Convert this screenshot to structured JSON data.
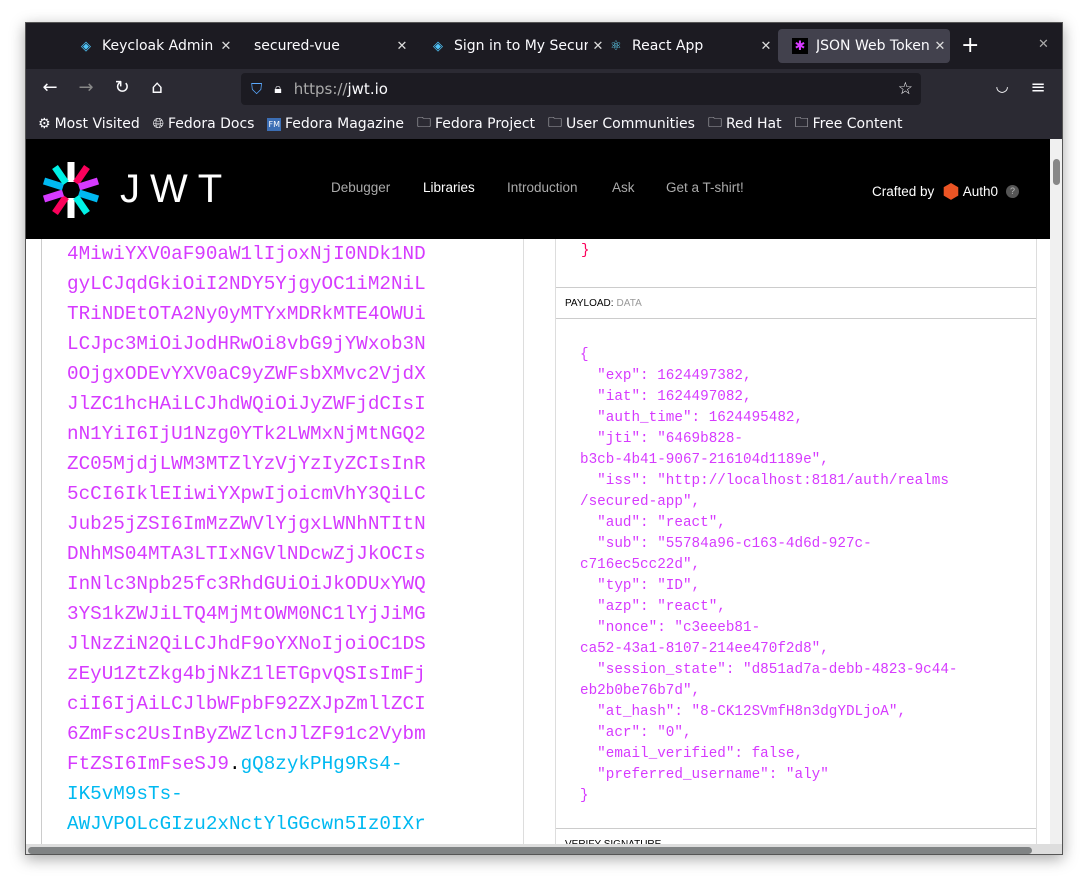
{
  "browser": {
    "tabs": [
      {
        "label": "Keycloak Admin Co",
        "icon": "keycloak-icon",
        "active": false
      },
      {
        "label": "secured-vue",
        "icon": "",
        "active": false
      },
      {
        "label": "Sign in to My Secur",
        "icon": "keycloak-icon",
        "active": false
      },
      {
        "label": "React App",
        "icon": "react-icon",
        "active": false
      },
      {
        "label": "JSON Web Tokens",
        "icon": "jwt-icon",
        "active": true
      }
    ],
    "url_protocol": "https://",
    "url_host": "jwt.io",
    "bookmarks": [
      {
        "label": "Most Visited",
        "icon": "gear-icon"
      },
      {
        "label": "Fedora Docs",
        "icon": "globe-icon"
      },
      {
        "label": "Fedora Magazine",
        "icon": "fm-icon"
      },
      {
        "label": "Fedora Project",
        "icon": "folder-icon"
      },
      {
        "label": "User Communities",
        "icon": "folder-icon"
      },
      {
        "label": "Red Hat",
        "icon": "folder-icon"
      },
      {
        "label": "Free Content",
        "icon": "folder-icon"
      }
    ]
  },
  "site": {
    "logo_text": "JWT",
    "menu": [
      "Debugger",
      "Libraries",
      "Introduction",
      "Ask",
      "Get a T-shirt!"
    ],
    "active_menu": "Libraries",
    "crafted_by": "Crafted by",
    "brand": "Auth0",
    "help": "?",
    "colors": {
      "payload": "#d63aff",
      "signature": "#00b9f1",
      "header": "#fb015b"
    }
  },
  "encoded": {
    "payload_lines": [
      "4MiwiYXV0aF90aW1lIjoxNjI0NDk1ND",
      "gyLCJqdGkiOiI2NDY5YjgyOC1iM2NiL",
      "TRiNDEtOTA2Ny0yMTYxMDRkMTE4OWUi",
      "LCJpc3MiOiJodHRwOi8vbG9jYWxob3N",
      "0OjgxODEvYXV0aC9yZWFsbXMvc2VjdX",
      "JlZC1hcHAiLCJhdWQiOiJyZWFjdCIsI",
      "nN1YiI6IjU1Nzg0YTk2LWMxNjMtNGQ2",
      "ZC05MjdjLWM3MTZlYzVjYzIyZCIsInR",
      "5cCI6IklEIiwiYXpwIjoicmVhY3QiLC",
      "Jub25jZSI6ImMzZWVlYjgxLWNhNTItN",
      "DNhMS04MTA3LTIxNGVlNDcwZjJkOCIs",
      "InNlc3Npb25fc3RhdGUiOiJkODUxYWQ",
      "3YS1kZWJiLTQ4MjMtOWM0NC1lYjJiMG",
      "JlNzZiN2QiLCJhdF9oYXNoIjoiOC1DS",
      "zEyU1ZtZkg4bjNkZ1lETGpvQSIsImFj",
      "ciI6IjAiLCJlbWFpbF92ZXJpZmllZCI",
      "6ZmFsc2UsInByZWZlcnJlZF91c2Vybm"
    ],
    "payload_tail": "FtZSI6ImFseSJ9",
    "dot": ".",
    "sig_head": "gQ8zykPHg9Rs4-",
    "sig_lines": [
      "IK5vM9sTs-",
      "AWJVPOLcGIzu2xNctYlGGcwn5Iz0IXr"
    ]
  },
  "decoded": {
    "header_close": "}",
    "payload_title": "PAYLOAD:",
    "payload_sub": "DATA",
    "payload_lines": [
      "{",
      "  \"exp\": 1624497382,",
      "  \"iat\": 1624497082,",
      "  \"auth_time\": 1624495482,",
      "  \"jti\": \"6469b828-",
      "b3cb-4b41-9067-216104d1189e\",",
      "  \"iss\": \"http://localhost:8181/auth/realms",
      "/secured-app\",",
      "  \"aud\": \"react\",",
      "  \"sub\": \"55784a96-c163-4d6d-927c-",
      "c716ec5cc22d\",",
      "  \"typ\": \"ID\",",
      "  \"azp\": \"react\",",
      "  \"nonce\": \"c3eeeb81-",
      "ca52-43a1-8107-214ee470f2d8\",",
      "  \"session_state\": \"d851ad7a-debb-4823-9c44-",
      "eb2b0be76b7d\",",
      "  \"at_hash\": \"8-CK12SVmfH8n3dgYDLjoA\",",
      "  \"acr\": \"0\",",
      "  \"email_verified\": false,",
      "  \"preferred_username\": \"aly\"",
      "}"
    ],
    "verify_title": "VERIFY SIGNATURE"
  }
}
